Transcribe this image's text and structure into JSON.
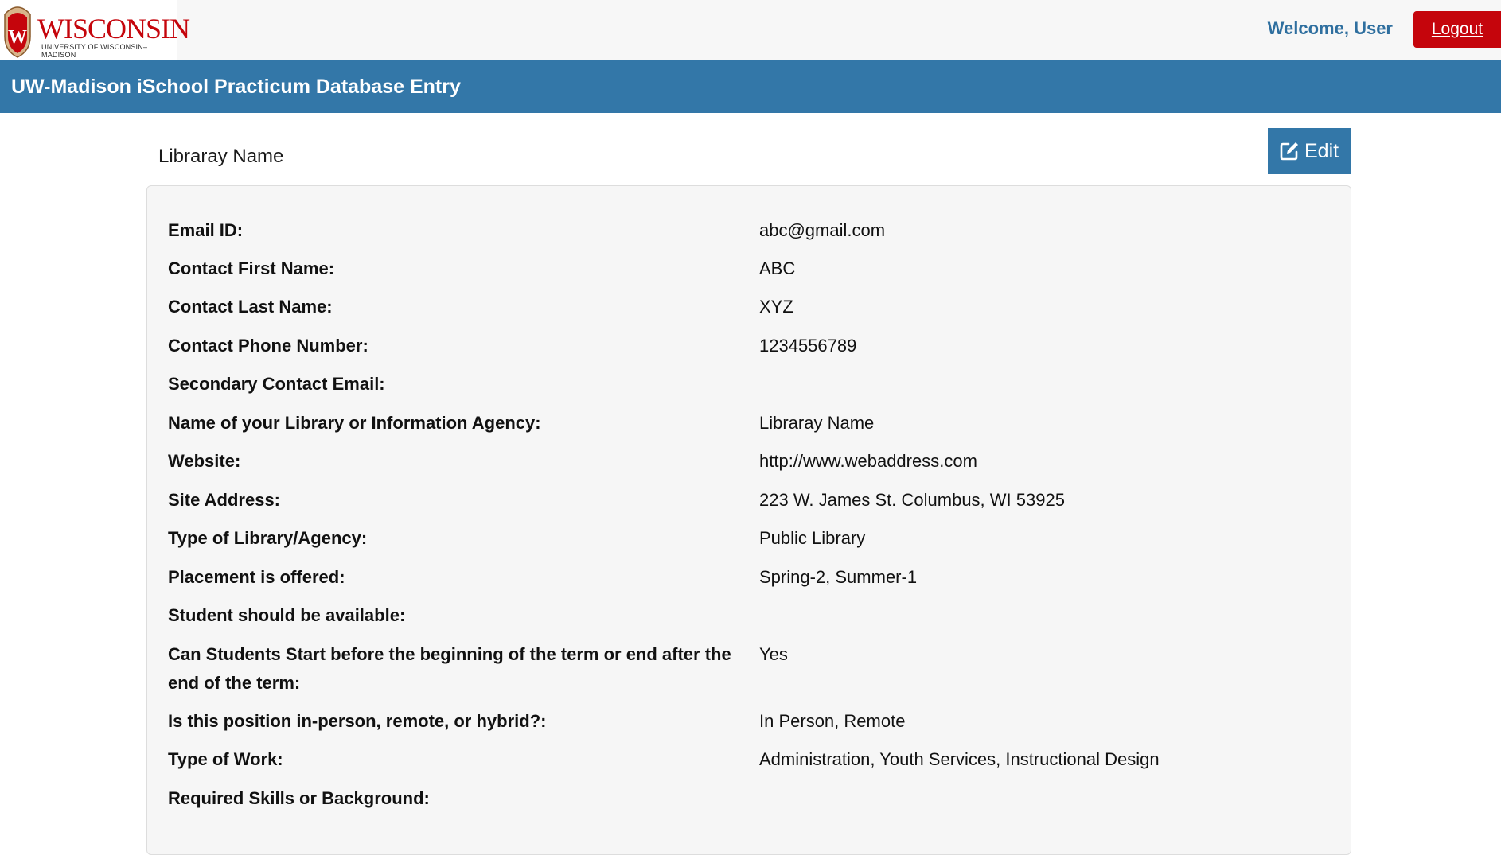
{
  "header": {
    "logo_text": "WISCONSIN",
    "logo_subtext": "UNIVERSITY OF WISCONSIN–MADISON",
    "welcome": "Welcome, User",
    "logout_label": "Logout"
  },
  "banner": {
    "title": "UW-Madison iSchool Practicum Database Entry"
  },
  "section": {
    "title": "Libraray Name",
    "edit_label": "Edit"
  },
  "details": [
    {
      "label": "Email ID:",
      "value": "abc@gmail.com"
    },
    {
      "label": "Contact First Name:",
      "value": "ABC"
    },
    {
      "label": "Contact Last Name:",
      "value": "XYZ"
    },
    {
      "label": "Contact Phone Number:",
      "value": "1234556789"
    },
    {
      "label": "Secondary Contact Email:",
      "value": ""
    },
    {
      "label": "Name of your Library or Information Agency:",
      "value": "Libraray Name"
    },
    {
      "label": "Website:",
      "value": "http://www.webaddress.com"
    },
    {
      "label": "Site Address:",
      "value": "223 W. James St. Columbus, WI 53925"
    },
    {
      "label": "Type of Library/Agency:",
      "value": "Public Library"
    },
    {
      "label": "Placement is offered:",
      "value": "Spring-2, Summer-1"
    },
    {
      "label": "Student should be available:",
      "value": ""
    },
    {
      "label": "Can Students Start before the beginning of the term or end after the end of the term:",
      "value": "Yes"
    },
    {
      "label": "Is this position in-person, remote, or hybrid?:",
      "value": "In Person, Remote"
    },
    {
      "label": "Type of Work:",
      "value": "Administration, Youth Services, Instructional Design"
    },
    {
      "label": "Required Skills or Background:",
      "value": ""
    }
  ],
  "colors": {
    "brand_red": "#c5050c",
    "banner_blue": "#3377a8",
    "welcome_blue": "#2f6f9f"
  },
  "icons": {
    "crest": "uw-crest-icon",
    "edit": "edit-icon"
  }
}
